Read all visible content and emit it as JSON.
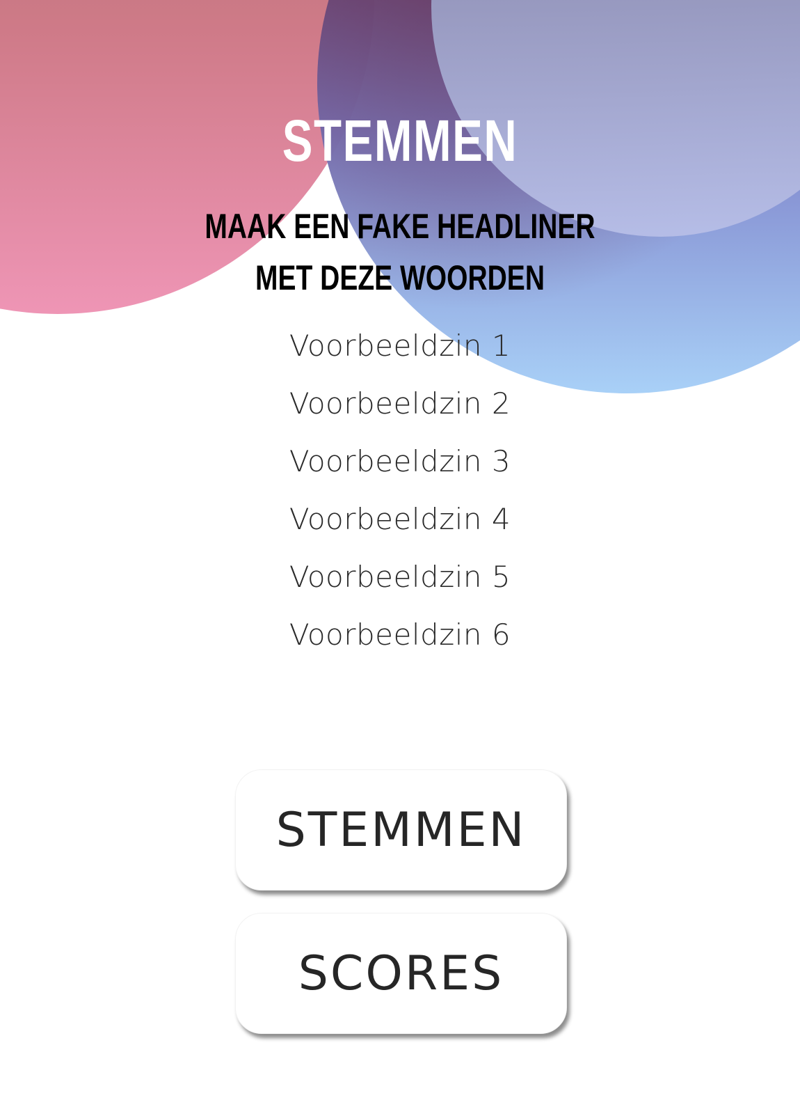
{
  "header": {
    "title": "STEMMEN",
    "subtitle_line1": "MAAK EEN FAKE HEADLINER",
    "subtitle_line2": "MET DEZE WOORDEN"
  },
  "sentences": [
    "Voorbeeldzin 1",
    "Voorbeeldzin 2",
    "Voorbeeldzin 3",
    "Voorbeeldzin 4",
    "Voorbeeldzin 5",
    "Voorbeeldzin 6"
  ],
  "buttons": {
    "vote_label": "STEMMEN",
    "scores_label": "SCORES"
  },
  "colors": {
    "background": "#ffffff",
    "pink_blob": "#e88aa9",
    "blue_blob": "#8aa6e6",
    "lavender_blob": "#b3b9e4",
    "title_text": "#ffffff",
    "subtitle_text": "#000000",
    "button_text": "#262626"
  }
}
